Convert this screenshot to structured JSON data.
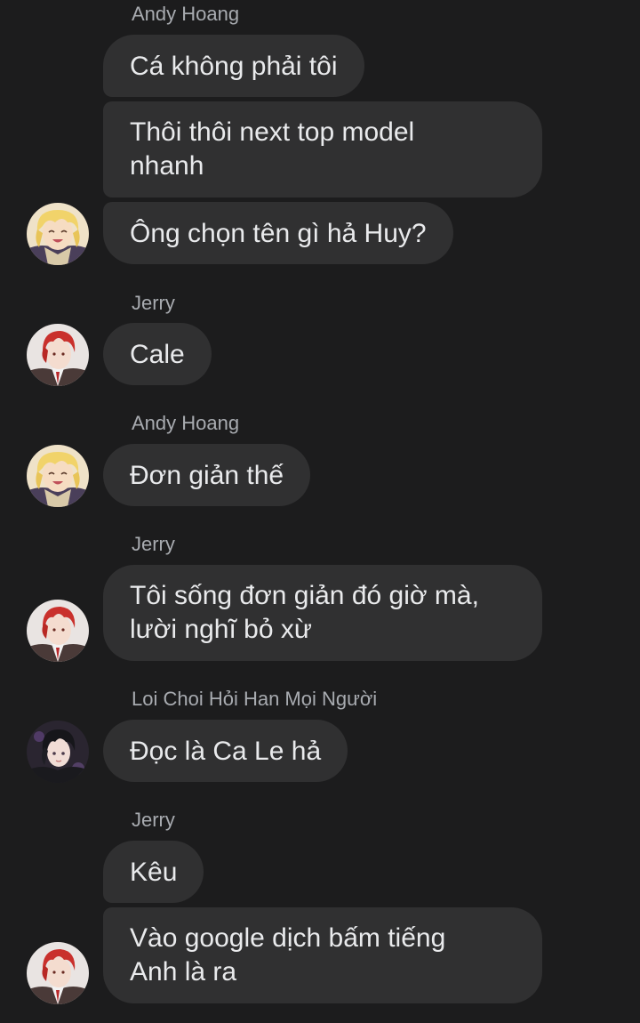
{
  "messages": {
    "g1": {
      "sender": "Andy Hoang",
      "m1": "Cá không phải tôi",
      "m2_l1": "Thôi thôi next top model",
      "m2_l2": "nhanh",
      "m3": "Ông chọn tên gì hả Huy?"
    },
    "g2": {
      "sender": "Jerry",
      "m1": "Cale"
    },
    "g3": {
      "sender": "Andy Hoang",
      "m1": "Đơn giản thế"
    },
    "g4": {
      "sender": "Jerry",
      "m1_l1": "Tôi sống đơn giản đó giờ mà,",
      "m1_l2": "lười nghĩ bỏ xừ"
    },
    "g5": {
      "sender": "Loi Choi Hỏi Han Mọi Người",
      "m1": "Đọc là Ca Le hả"
    },
    "g6": {
      "sender": "Jerry",
      "m1": "Kêu",
      "m2_l1": "Vào google dịch bấm tiếng",
      "m2_l2": "Anh là ra"
    }
  },
  "avatars": {
    "andy": "blonde-anime-avatar",
    "jerry": "red-hair-anime-avatar",
    "loi_choi": "dark-hair-anime-avatar"
  },
  "colors": {
    "background": "#1c1c1d",
    "bubble": "#303031",
    "sender_text": "#a8abb0",
    "message_text": "#e9eaec"
  }
}
